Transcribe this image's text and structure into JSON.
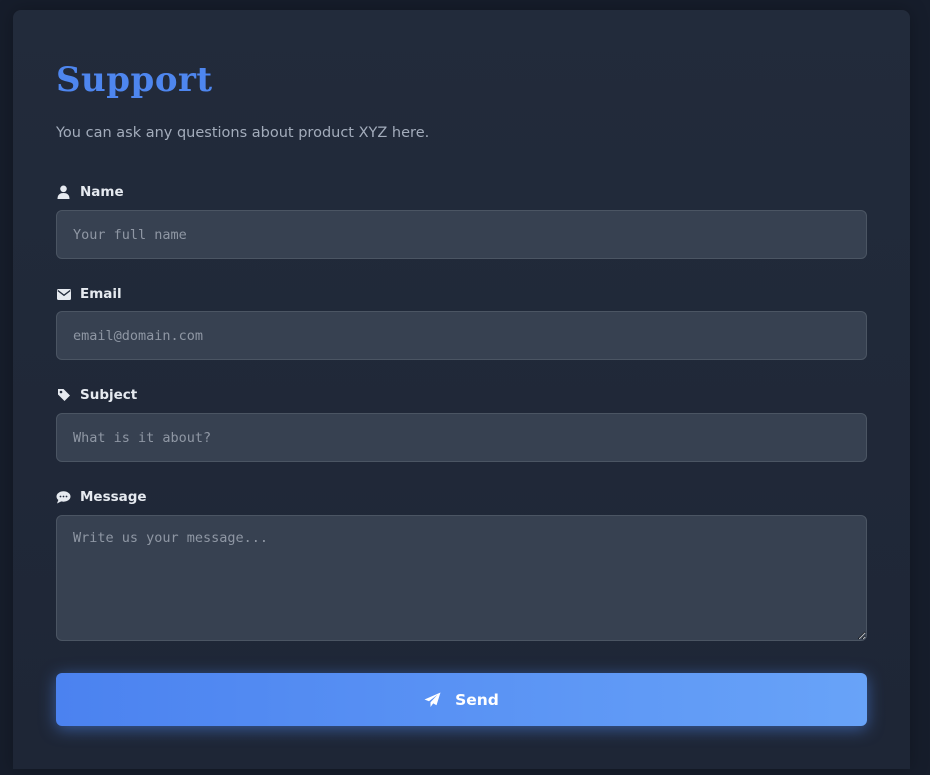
{
  "header": {
    "title": "Support",
    "subtitle": "You can ask any questions about product XYZ here."
  },
  "form": {
    "name": {
      "label": "Name",
      "placeholder": "Your full name",
      "icon": "user-icon"
    },
    "email": {
      "label": "Email",
      "placeholder": "email@domain.com",
      "icon": "envelope-icon"
    },
    "subject": {
      "label": "Subject",
      "placeholder": "What is it about?",
      "icon": "tag-icon"
    },
    "message": {
      "label": "Message",
      "placeholder": "Write us your message...",
      "icon": "comment-icon"
    },
    "send": {
      "label": "Send",
      "icon": "paper-plane-icon"
    }
  },
  "colors": {
    "accent": "#4e86ef",
    "background": "#161d2b",
    "card": "#222b3b",
    "field": "#374151"
  }
}
